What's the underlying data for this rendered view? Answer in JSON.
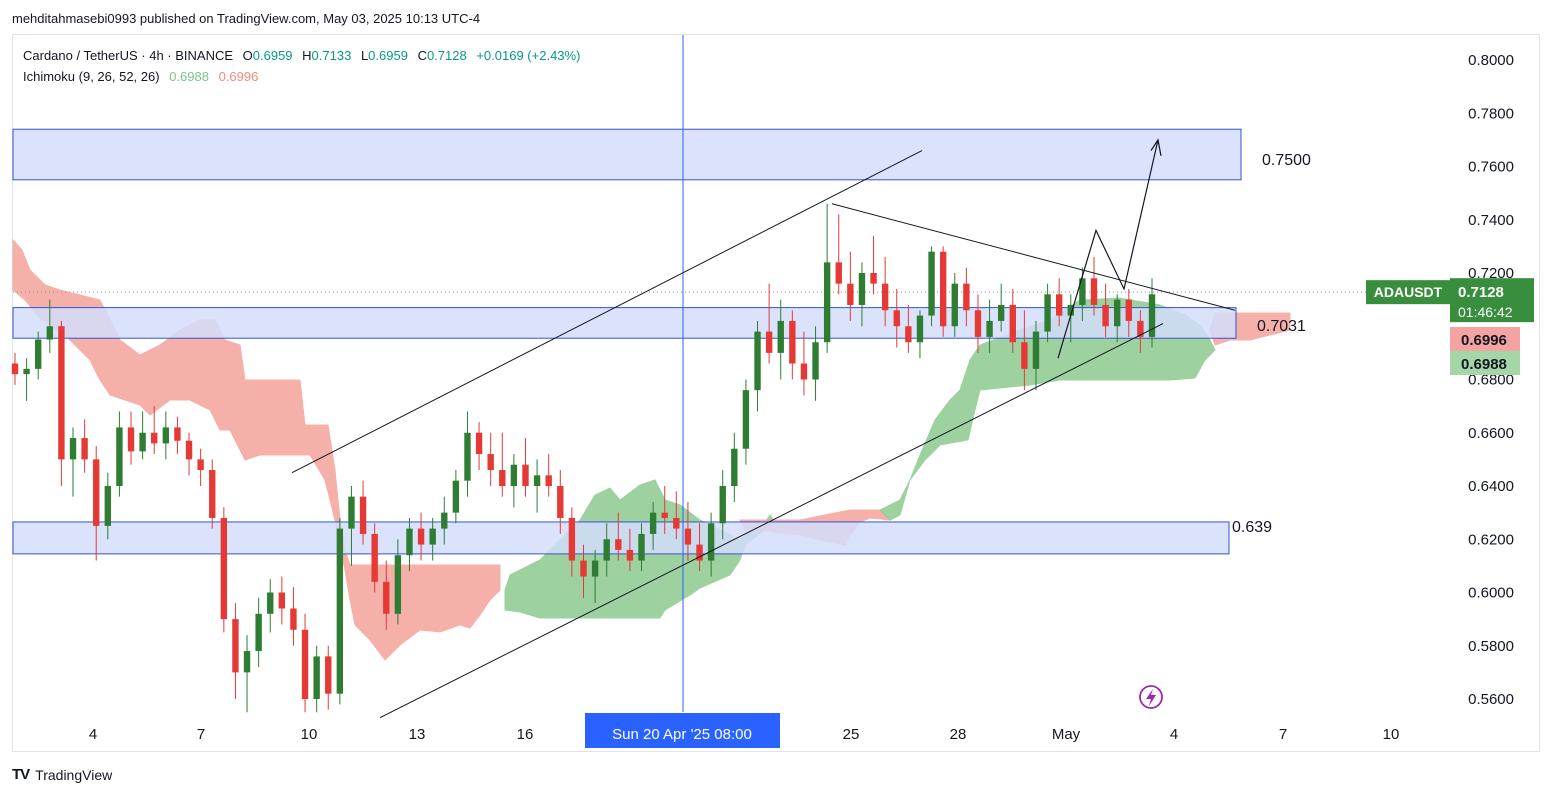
{
  "publisher_line": "mehditahmasebi0993 published on TradingView.com, May 03, 2025 10:13 UTC-4",
  "legend": {
    "symbol": "Cardano / TetherUS · 4h · BINANCE",
    "o_label": "O",
    "o": "0.6959",
    "h_label": "H",
    "h": "0.7133",
    "l_label": "L",
    "l": "0.6959",
    "c_label": "C",
    "c": "0.7128",
    "change": "+0.0169 (+2.43%)",
    "indicator": "Ichimoku (9, 26, 52, 26)",
    "ind_v1": "0.6988",
    "ind_v2": "0.6996"
  },
  "footer": {
    "brand": "TradingView"
  },
  "colors": {
    "up": "#2e7d32",
    "down": "#e53935",
    "cloud_up": "#8cc98f",
    "cloud_down": "#f4a39b",
    "zone": "#d3ddfb",
    "zone_border": "#3554d1",
    "cursor_line": "#2962ff",
    "price_label_bg": "#388e3c",
    "lead_a_label_bg": "#f4a3a3",
    "lead_b_label_bg": "#a5d6a7"
  },
  "chart_data": {
    "type": "candlestick",
    "symbol": "ADAUSDT",
    "timeframe": "4h",
    "y_axis": {
      "min": 0.55,
      "max": 0.805,
      "ticks": [
        "0.8000",
        "0.7800",
        "0.7600",
        "0.7400",
        "0.7200",
        "0.6800",
        "0.6600",
        "0.6400",
        "0.6200",
        "0.6000",
        "0.5800",
        "0.5600"
      ]
    },
    "x_axis": {
      "ticks": [
        "4",
        "7",
        "10",
        "13",
        "16",
        "25",
        "28",
        "May",
        "4",
        "7",
        "10"
      ],
      "cursor_label": "Sun 20 Apr '25   08:00"
    },
    "current_price": {
      "symbol_label": "ADAUSDT",
      "price": "0.7128",
      "countdown": "01:46:42"
    },
    "ichimoku_labels": {
      "senkou_b": "0.6996",
      "senkou_a": "0.6988"
    },
    "zones": [
      {
        "label": "0.7500",
        "top": 0.774,
        "bottom": 0.755
      },
      {
        "label": "0.7031",
        "top": 0.707,
        "bottom": 0.6955
      },
      {
        "label": "0.639",
        "top": 0.6265,
        "bottom": 0.6145
      }
    ],
    "trendlines": [
      {
        "name": "channel-upper",
        "from": [
          0.645
        ],
        "to": [
          0.766
        ]
      },
      {
        "name": "channel-lower",
        "from": [
          0.553
        ],
        "to": [
          0.701
        ]
      },
      {
        "name": "triangle-upper",
        "from": [
          0.746
        ],
        "to": [
          0.706
        ]
      }
    ],
    "projection_path": [
      0.688,
      0.736,
      0.714,
      0.77
    ],
    "candles_ohlc": [
      [
        0.686,
        0.69,
        0.678,
        0.682
      ],
      [
        0.682,
        0.688,
        0.672,
        0.684
      ],
      [
        0.684,
        0.698,
        0.68,
        0.695
      ],
      [
        0.695,
        0.71,
        0.69,
        0.7
      ],
      [
        0.7,
        0.702,
        0.64,
        0.65
      ],
      [
        0.65,
        0.662,
        0.636,
        0.658
      ],
      [
        0.658,
        0.665,
        0.645,
        0.65
      ],
      [
        0.65,
        0.655,
        0.612,
        0.625
      ],
      [
        0.625,
        0.645,
        0.62,
        0.64
      ],
      [
        0.64,
        0.668,
        0.636,
        0.662
      ],
      [
        0.662,
        0.668,
        0.648,
        0.653
      ],
      [
        0.653,
        0.668,
        0.65,
        0.66
      ],
      [
        0.66,
        0.67,
        0.652,
        0.656
      ],
      [
        0.656,
        0.668,
        0.65,
        0.662
      ],
      [
        0.662,
        0.666,
        0.652,
        0.657
      ],
      [
        0.657,
        0.66,
        0.644,
        0.65
      ],
      [
        0.65,
        0.654,
        0.64,
        0.646
      ],
      [
        0.646,
        0.65,
        0.624,
        0.628
      ],
      [
        0.628,
        0.632,
        0.585,
        0.59
      ],
      [
        0.59,
        0.596,
        0.56,
        0.57
      ],
      [
        0.57,
        0.584,
        0.555,
        0.578
      ],
      [
        0.578,
        0.598,
        0.572,
        0.592
      ],
      [
        0.592,
        0.605,
        0.585,
        0.6
      ],
      [
        0.6,
        0.606,
        0.588,
        0.594
      ],
      [
        0.594,
        0.602,
        0.58,
        0.586
      ],
      [
        0.586,
        0.592,
        0.555,
        0.56
      ],
      [
        0.56,
        0.58,
        0.555,
        0.576
      ],
      [
        0.576,
        0.58,
        0.556,
        0.562
      ],
      [
        0.562,
        0.628,
        0.558,
        0.624
      ],
      [
        0.624,
        0.64,
        0.61,
        0.636
      ],
      [
        0.636,
        0.642,
        0.618,
        0.622
      ],
      [
        0.622,
        0.626,
        0.6,
        0.604
      ],
      [
        0.604,
        0.612,
        0.586,
        0.592
      ],
      [
        0.592,
        0.62,
        0.588,
        0.614
      ],
      [
        0.614,
        0.628,
        0.608,
        0.624
      ],
      [
        0.624,
        0.63,
        0.612,
        0.618
      ],
      [
        0.618,
        0.628,
        0.612,
        0.624
      ],
      [
        0.624,
        0.636,
        0.618,
        0.63
      ],
      [
        0.63,
        0.646,
        0.626,
        0.642
      ],
      [
        0.642,
        0.668,
        0.636,
        0.66
      ],
      [
        0.66,
        0.664,
        0.646,
        0.652
      ],
      [
        0.652,
        0.66,
        0.64,
        0.646
      ],
      [
        0.646,
        0.66,
        0.636,
        0.64
      ],
      [
        0.64,
        0.652,
        0.632,
        0.648
      ],
      [
        0.648,
        0.658,
        0.636,
        0.64
      ],
      [
        0.64,
        0.65,
        0.63,
        0.644
      ],
      [
        0.644,
        0.652,
        0.636,
        0.64
      ],
      [
        0.64,
        0.646,
        0.622,
        0.628
      ],
      [
        0.628,
        0.632,
        0.606,
        0.612
      ],
      [
        0.612,
        0.618,
        0.598,
        0.606
      ],
      [
        0.606,
        0.616,
        0.596,
        0.612
      ],
      [
        0.612,
        0.626,
        0.606,
        0.62
      ],
      [
        0.62,
        0.63,
        0.612,
        0.616
      ],
      [
        0.616,
        0.624,
        0.608,
        0.612
      ],
      [
        0.612,
        0.626,
        0.608,
        0.622
      ],
      [
        0.622,
        0.634,
        0.616,
        0.63
      ],
      [
        0.63,
        0.64,
        0.622,
        0.628
      ],
      [
        0.628,
        0.638,
        0.62,
        0.624
      ],
      [
        0.624,
        0.634,
        0.612,
        0.618
      ],
      [
        0.618,
        0.626,
        0.608,
        0.612
      ],
      [
        0.612,
        0.63,
        0.606,
        0.626
      ],
      [
        0.626,
        0.646,
        0.62,
        0.64
      ],
      [
        0.64,
        0.66,
        0.634,
        0.654
      ],
      [
        0.654,
        0.68,
        0.648,
        0.676
      ],
      [
        0.676,
        0.702,
        0.668,
        0.698
      ],
      [
        0.698,
        0.716,
        0.686,
        0.69
      ],
      [
        0.69,
        0.71,
        0.68,
        0.702
      ],
      [
        0.702,
        0.706,
        0.68,
        0.686
      ],
      [
        0.686,
        0.698,
        0.674,
        0.68
      ],
      [
        0.68,
        0.7,
        0.672,
        0.694
      ],
      [
        0.694,
        0.746,
        0.69,
        0.724
      ],
      [
        0.724,
        0.742,
        0.712,
        0.716
      ],
      [
        0.716,
        0.728,
        0.702,
        0.708
      ],
      [
        0.708,
        0.724,
        0.7,
        0.72
      ],
      [
        0.72,
        0.734,
        0.712,
        0.716
      ],
      [
        0.716,
        0.726,
        0.7,
        0.706
      ],
      [
        0.706,
        0.714,
        0.692,
        0.7
      ],
      [
        0.7,
        0.708,
        0.69,
        0.694
      ],
      [
        0.694,
        0.706,
        0.688,
        0.704
      ],
      [
        0.704,
        0.73,
        0.7,
        0.728
      ],
      [
        0.728,
        0.73,
        0.696,
        0.7
      ],
      [
        0.7,
        0.72,
        0.696,
        0.716
      ],
      [
        0.716,
        0.722,
        0.7,
        0.706
      ],
      [
        0.706,
        0.712,
        0.69,
        0.696
      ],
      [
        0.696,
        0.71,
        0.69,
        0.702
      ],
      [
        0.702,
        0.716,
        0.698,
        0.708
      ],
      [
        0.708,
        0.714,
        0.69,
        0.694
      ],
      [
        0.694,
        0.706,
        0.676,
        0.684
      ],
      [
        0.684,
        0.702,
        0.676,
        0.698
      ],
      [
        0.698,
        0.716,
        0.694,
        0.712
      ],
      [
        0.712,
        0.718,
        0.7,
        0.704
      ],
      [
        0.704,
        0.712,
        0.694,
        0.708
      ],
      [
        0.708,
        0.722,
        0.702,
        0.718
      ],
      [
        0.718,
        0.726,
        0.704,
        0.708
      ],
      [
        0.708,
        0.716,
        0.696,
        0.7
      ],
      [
        0.7,
        0.712,
        0.694,
        0.71
      ],
      [
        0.71,
        0.714,
        0.696,
        0.702
      ],
      [
        0.702,
        0.706,
        0.69,
        0.696
      ],
      [
        0.696,
        0.718,
        0.692,
        0.712
      ]
    ]
  }
}
